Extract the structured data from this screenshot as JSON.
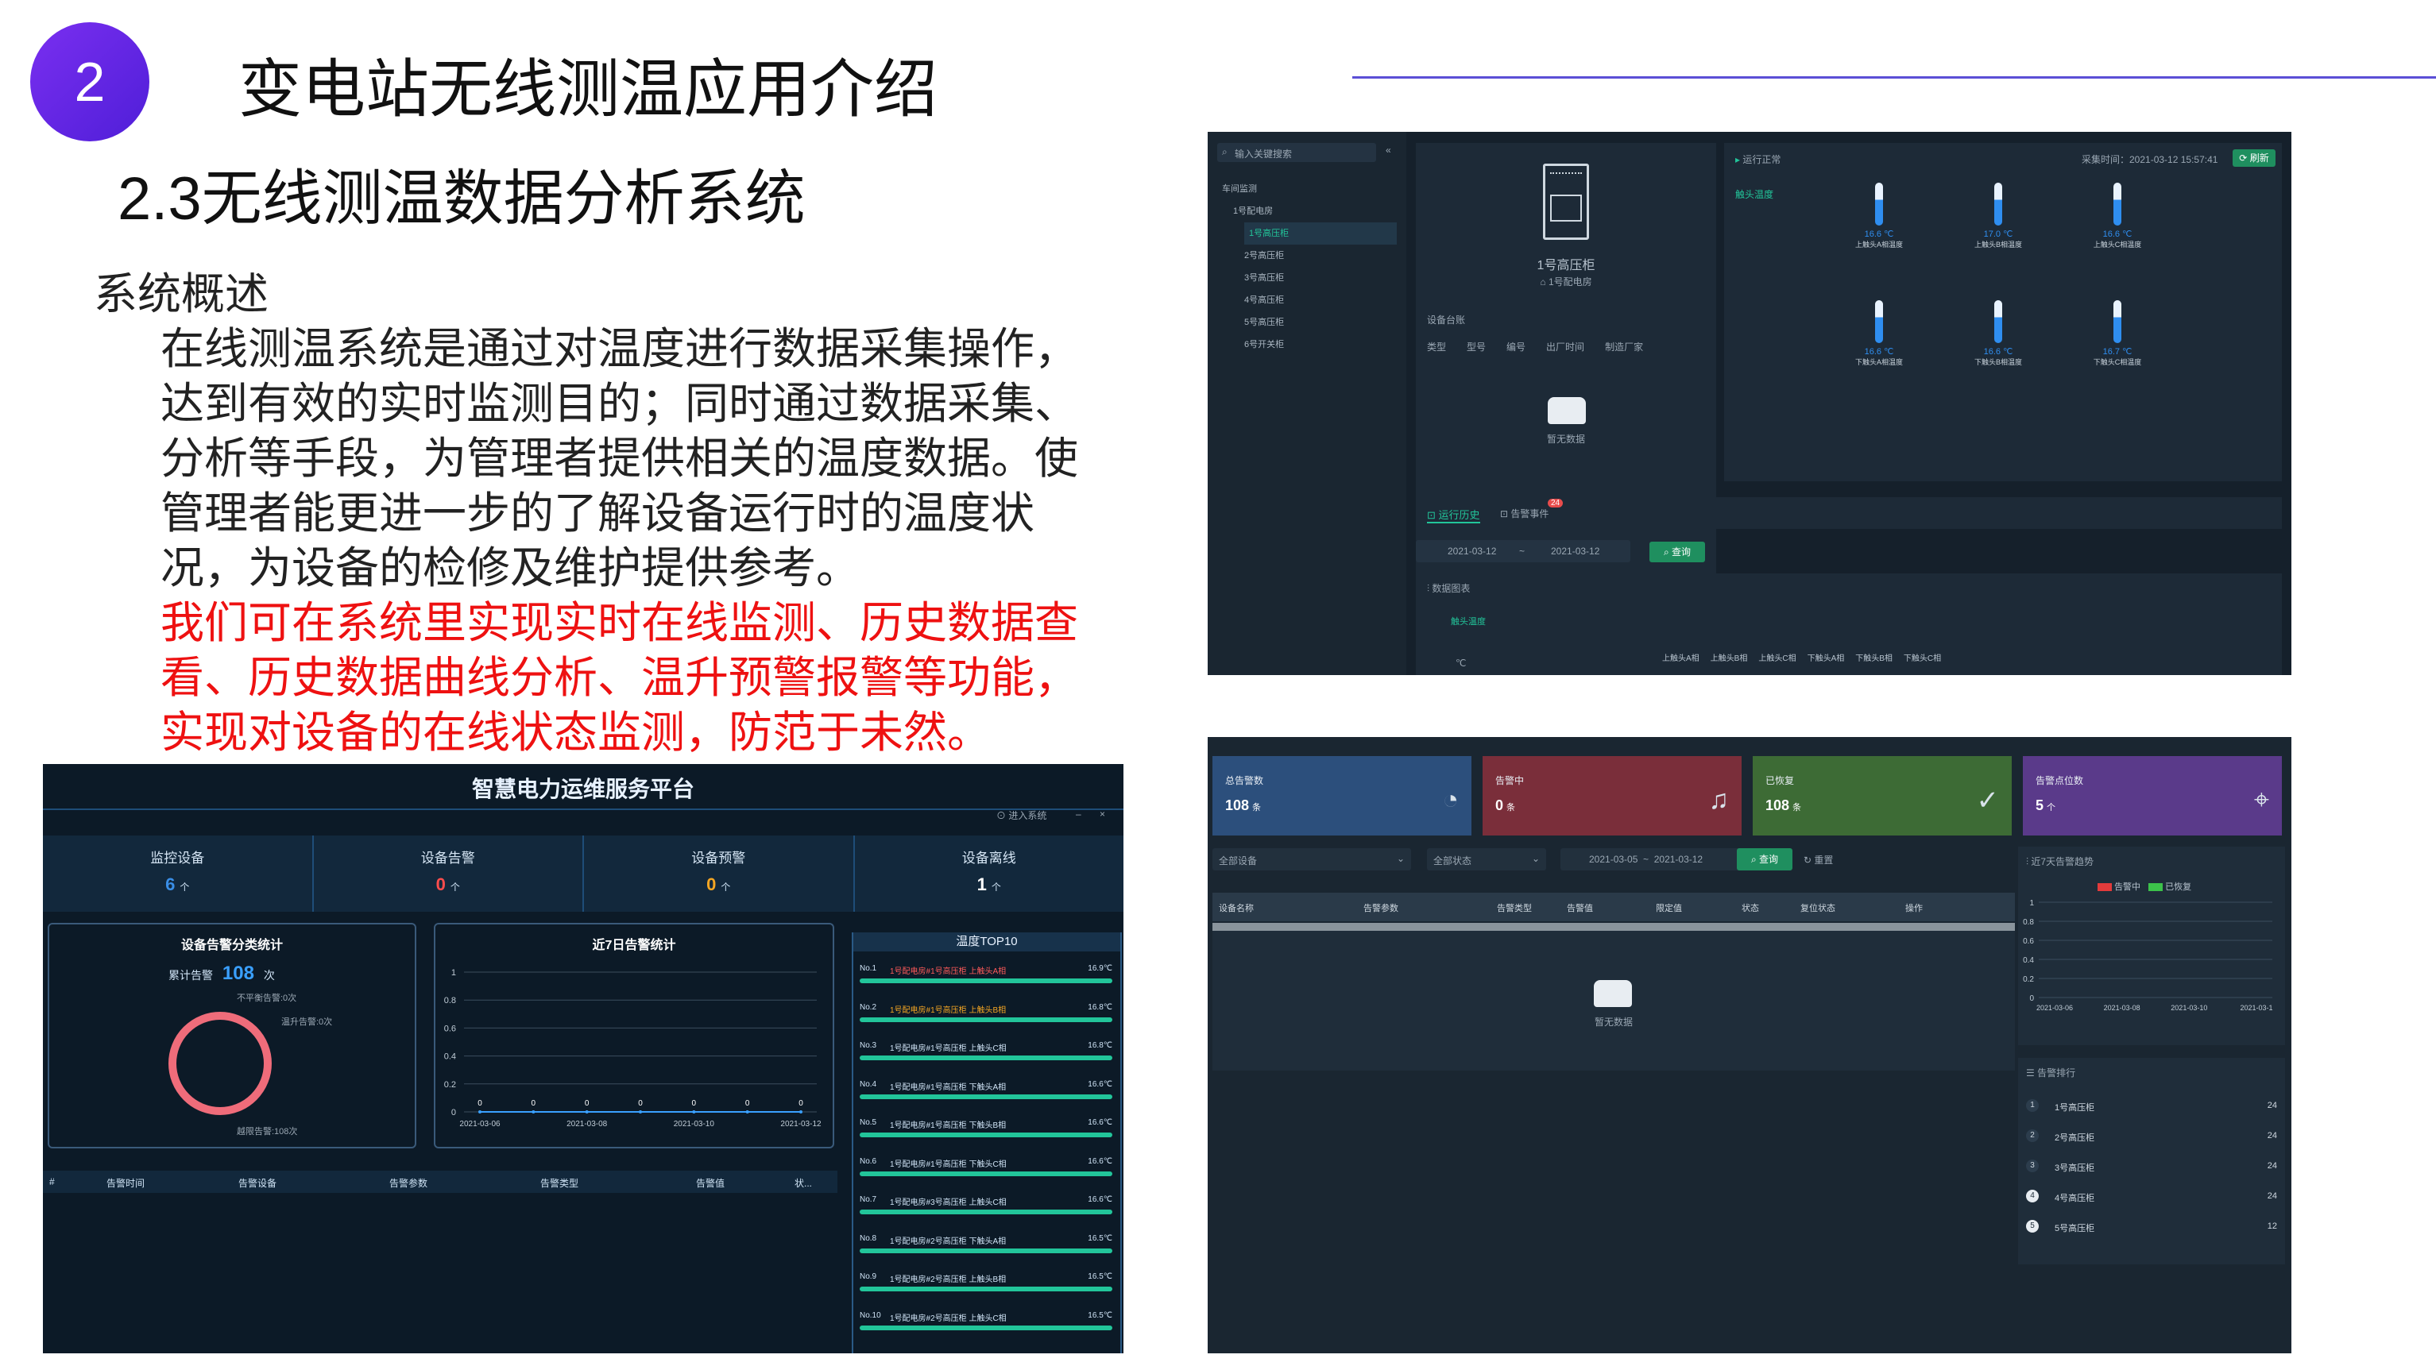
{
  "header": {
    "number": "2",
    "title": "变电站无线测温应用介绍",
    "subtitle": "2.3无线测温数据分析系统"
  },
  "body": {
    "heading": "系统概述",
    "para1": "在线测温系统是通过对温度进行数据采集操作，达到有效的实时监测目的；同时通过数据采集、分析等手段，为管理者提供相关的温度数据。使管理者能更进一步的了解设备运行时的温度状况，为设备的检修及维护提供参考。",
    "para2_red": "我们可在系统里实现实时在线监测、历史数据查看、历史数据曲线分析、温升预警报警等功能，实现对设备的在线状态监测，防范于未然。"
  },
  "shot_a": {
    "search_placeholder": "输入关键搜索",
    "tree": [
      "车间监测",
      "1号配电房",
      "1号高压柜",
      "2号高压柜",
      "3号高压柜",
      "4号高压柜",
      "5号高压柜",
      "6号开关柜"
    ],
    "device_name": "1号高压柜",
    "device_location": "1号配电房",
    "ledger_title": "设备台账",
    "ledger_cols": [
      "类型",
      "型号",
      "编号",
      "出厂时间",
      "制造厂家"
    ],
    "no_data": "暂无数据",
    "status_title": "运行正常",
    "collect_time": "采集时间：2021-03-12 15:57:41",
    "refresh_label": "刷新",
    "side_tab": "触头温度",
    "sensors": [
      {
        "temp": "16.6 ℃",
        "label": "上触头A相温度"
      },
      {
        "temp": "17.0 ℃",
        "label": "上触头B相温度"
      },
      {
        "temp": "16.6 ℃",
        "label": "上触头C相温度"
      },
      {
        "temp": "16.6 ℃",
        "label": "下触头A相温度"
      },
      {
        "temp": "16.6 ℃",
        "label": "下触头B相温度"
      },
      {
        "temp": "16.7 ℃",
        "label": "下触头C相温度"
      }
    ],
    "tab_run": "运行历史",
    "tab_alarm": "告警事件",
    "alarm_badge": "24",
    "date_from": "2021-03-12",
    "date_sep": "~",
    "date_to": "2021-03-12",
    "query_label": "查询",
    "chart_title": "数据图表",
    "chart_tab": "触头温度",
    "y_unit": "℃",
    "legend": [
      "上触头A相",
      "上触头B相",
      "上触头C相",
      "下触头A相",
      "下触头B相",
      "下触头C相"
    ]
  },
  "shot_b": {
    "platform_title": "智慧电力运维服务平台",
    "enter_system": "进入系统",
    "stats": [
      {
        "label": "监控设备",
        "value": "6",
        "unit": "个",
        "color": "#3a8ee6"
      },
      {
        "label": "设备告警",
        "value": "0",
        "unit": "个",
        "color": "#ff4d4d"
      },
      {
        "label": "设备预警",
        "value": "0",
        "unit": "个",
        "color": "#f5a623"
      },
      {
        "label": "设备离线",
        "value": "1",
        "unit": "个",
        "color": "#ffffff"
      }
    ],
    "alarm_class_title": "设备告警分类统计",
    "cum_label": "累计告警",
    "cum_value": "108",
    "cum_unit": "次",
    "ring_labels": [
      "不平衡告警:0次",
      "温升告警:0次",
      "越限告警:108次"
    ],
    "weekly_title": "近7日告警统计",
    "top10_title": "温度TOP10",
    "top10": [
      {
        "no": "No.1",
        "name": "1号配电房#1号高压柜 上触头A相",
        "temp": "16.9℃"
      },
      {
        "no": "No.2",
        "name": "1号配电房#1号高压柜 上触头B相",
        "temp": "16.8℃"
      },
      {
        "no": "No.3",
        "name": "1号配电房#1号高压柜 上触头C相",
        "temp": "16.8℃"
      },
      {
        "no": "No.4",
        "name": "1号配电房#1号高压柜 下触头A相",
        "temp": "16.6℃"
      },
      {
        "no": "No.5",
        "name": "1号配电房#1号高压柜 下触头B相",
        "temp": "16.6℃"
      },
      {
        "no": "No.6",
        "name": "1号配电房#1号高压柜 下触头C相",
        "temp": "16.6℃"
      },
      {
        "no": "No.7",
        "name": "1号配电房#3号高压柜 上触头C相",
        "temp": "16.6℃"
      },
      {
        "no": "No.8",
        "name": "1号配电房#2号高压柜 下触头A相",
        "temp": "16.5℃"
      },
      {
        "no": "No.9",
        "name": "1号配电房#2号高压柜 上触头B相",
        "temp": "16.5℃"
      },
      {
        "no": "No.10",
        "name": "1号配电房#2号高压柜 上触头C相",
        "temp": "16.5℃"
      }
    ],
    "table_cols": [
      "#",
      "告警时间",
      "告警设备",
      "告警参数",
      "告警类型",
      "告警值",
      "状..."
    ]
  },
  "chart_data": {
    "type": "line",
    "title": "近7日告警统计",
    "x": [
      "2021-03-06",
      "2021-03-07",
      "2021-03-08",
      "2021-03-09",
      "2021-03-10",
      "2021-03-11",
      "2021-03-12"
    ],
    "x_ticks_shown": [
      "2021-03-06",
      "2021-03-08",
      "2021-03-10",
      "2021-03-12"
    ],
    "series": [
      {
        "values": [
          0,
          0,
          0,
          0,
          0,
          0,
          0
        ]
      }
    ],
    "yticks": [
      "0",
      "0.2",
      "0.4",
      "0.6",
      "0.8",
      "1"
    ],
    "ylim": [
      0,
      1
    ],
    "grid": true
  },
  "shot_c": {
    "cards": [
      {
        "title": "总告警数",
        "value": "108",
        "unit": "条",
        "color": "#2c4f7c"
      },
      {
        "title": "告警中",
        "value": "0",
        "unit": "条",
        "color": "#7a2e3a"
      },
      {
        "title": "已恢复",
        "value": "108",
        "unit": "条",
        "color": "#3d6b35"
      },
      {
        "title": "告警点位数",
        "value": "5",
        "unit": "个",
        "color": "#5a3a8a"
      }
    ],
    "filter_device": "全部设备",
    "filter_status": "全部状态",
    "date_range": "2021-03-05  ~  2021-03-12",
    "query_label": "查询",
    "reset_label": "重置",
    "table_cols": [
      "设备名称",
      "告警参数",
      "告警类型",
      "告警值",
      "限定值",
      "状态",
      "复位状态",
      "操作"
    ],
    "no_data": "暂无数据",
    "trend_title": "近7天告警趋势",
    "trend_legend": [
      "告警中",
      "已恢复"
    ],
    "trend_yticks": [
      "0",
      "0.2",
      "0.4",
      "0.6",
      "0.8",
      "1"
    ],
    "trend_x": [
      "2021-03-06",
      "2021-03-08",
      "2021-03-10",
      "2021-03-1"
    ],
    "rank_title": "告警排行",
    "rank": [
      {
        "n": "1",
        "name": "1号高压柜",
        "count": "24"
      },
      {
        "n": "2",
        "name": "2号高压柜",
        "count": "24"
      },
      {
        "n": "3",
        "name": "3号高压柜",
        "count": "24"
      },
      {
        "n": "4",
        "name": "4号高压柜",
        "count": "24"
      },
      {
        "n": "5",
        "name": "5号高压柜",
        "count": "12"
      }
    ]
  }
}
